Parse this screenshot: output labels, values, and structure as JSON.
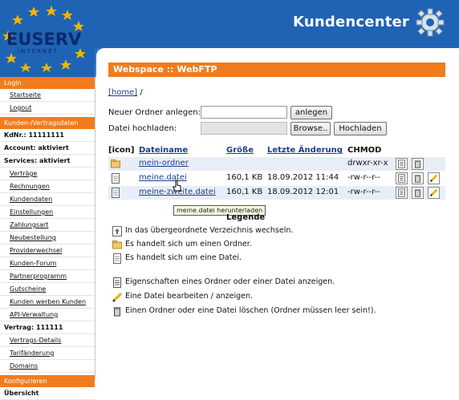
{
  "header": {
    "logo_text": "EUSERV",
    "logo_sub": "INTERNET",
    "title": "Kundencenter"
  },
  "sidebar": {
    "items": [
      {
        "type": "head",
        "label": "Login"
      },
      {
        "type": "link",
        "label": "Startseite"
      },
      {
        "type": "link",
        "label": "Logout"
      },
      {
        "type": "head",
        "label": "Kunden-/Vertragsdaten"
      },
      {
        "type": "info",
        "label": "KdNr.: 11111111"
      },
      {
        "type": "info",
        "label": "Account: aktiviert"
      },
      {
        "type": "info",
        "label": "Services: aktiviert"
      },
      {
        "type": "link",
        "label": "Verträge"
      },
      {
        "type": "link",
        "label": "Rechnungen"
      },
      {
        "type": "link",
        "label": "Kundendaten"
      },
      {
        "type": "link",
        "label": "Einstellungen"
      },
      {
        "type": "link",
        "label": "Zahlungsart"
      },
      {
        "type": "link",
        "label": "Neubestellung"
      },
      {
        "type": "link",
        "label": "Providerwechsel"
      },
      {
        "type": "link",
        "label": "Kunden-Forum"
      },
      {
        "type": "link",
        "label": "Partnerprogramm"
      },
      {
        "type": "link",
        "label": "Gutscheine"
      },
      {
        "type": "link",
        "label": "Kunden werben Kunden"
      },
      {
        "type": "link",
        "label": "API-Verwaltung"
      },
      {
        "type": "info",
        "label": "Vertrag: 111111"
      },
      {
        "type": "link",
        "label": "Vertrags-Details"
      },
      {
        "type": "link",
        "label": "Tarifänderung"
      },
      {
        "type": "link",
        "label": "Domains"
      },
      {
        "type": "head",
        "label": "Konfigurieren"
      },
      {
        "type": "info",
        "label": "Übersicht"
      }
    ]
  },
  "main": {
    "title": "Webspace :: WebFTP",
    "breadcrumb_home": "[home]",
    "breadcrumb_sep": "/",
    "new_folder_label": "Neuer Ordner anlegen:",
    "new_folder_value": "",
    "create_button": "anlegen",
    "upload_label": "Datei hochladen:",
    "browse_button": "Browse..",
    "upload_button": "Hochladen"
  },
  "table": {
    "headers": [
      "[icon]",
      "Dateiname",
      "Größe",
      "Letzte Änderung",
      "CHMOD"
    ],
    "rows": [
      {
        "icon": "folder-icon",
        "name": "mein-ordner",
        "size": "",
        "date": "",
        "chmod": "drwxr-xr-x"
      },
      {
        "icon": "file-icon",
        "name": "meine.datei",
        "size": "160,1 KB",
        "date": "18.09.2012 11:44",
        "chmod": "-rw-r--r--"
      },
      {
        "icon": "file-icon",
        "name": "meine-zweite.datei",
        "size": "160,1 KB",
        "date": "18.09.2012 12:01",
        "chmod": "-rw-r--r--"
      }
    ]
  },
  "tooltip": "meine.datei herunterladen",
  "legend": {
    "title": "Legende",
    "items": [
      "In das übergeordnete Verzeichnis wechseln.",
      "Es handelt sich um einen Ordner.",
      "Es handelt sich um eine Datei.",
      "Eigenschaften eines Ordner oder einer Datei anzeigen.",
      "Eine Datei bearbeiten / anzeigen.",
      "Einen Ordner oder eine Datei löschen (Ordner müssen leer sein!)."
    ]
  },
  "colors": {
    "header_blue": "#1f63b4",
    "accent_orange": "#f07c1e",
    "link_blue": "#1a3e8c",
    "row_shade": "#e8eef7"
  }
}
